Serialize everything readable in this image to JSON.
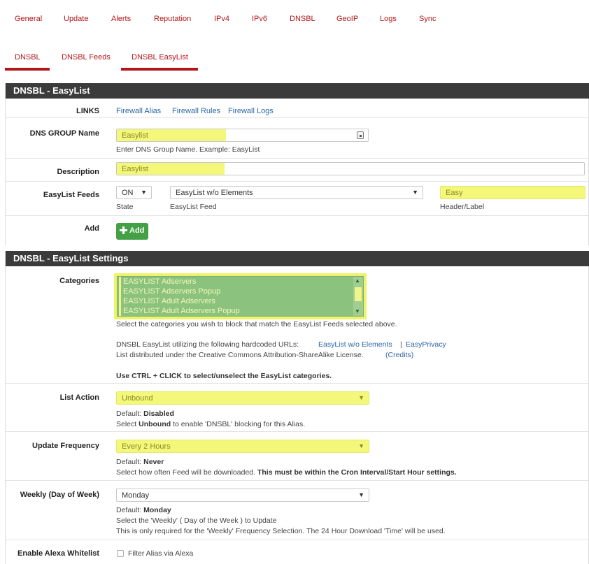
{
  "top_tabs": [
    "General",
    "Update",
    "Alerts",
    "Reputation",
    "IPv4",
    "IPv6",
    "DNSBL",
    "GeoIP",
    "Logs",
    "Sync"
  ],
  "sub_tabs": [
    "DNSBL",
    "DNSBL Feeds",
    "DNSBL EasyList"
  ],
  "panel1": {
    "title": "DNSBL - EasyList",
    "links_label": "LINKS",
    "links": [
      "Firewall Alias",
      "Firewall Rules",
      "Firewall Logs"
    ],
    "dns_group_label": "DNS GROUP Name",
    "dns_group_value": "Easylist",
    "dns_group_help": "Enter DNS Group Name.     Example: EasyList",
    "description_label": "Description",
    "description_value": "Easylist",
    "feeds_label": "EasyList Feeds",
    "state_value": "ON",
    "state_sub": "State",
    "feed_value": "EasyList w/o Elements",
    "feed_sub": "EasyList Feed",
    "header_value": "Easy",
    "header_sub": "Header/Label",
    "add_label": "Add",
    "add_button": "Add"
  },
  "panel2": {
    "title": "DNSBL - EasyList Settings",
    "categories_label": "Categories",
    "categories": [
      "EASYLIST Adservers",
      "EASYLIST Adservers Popup",
      "EASYLIST Adult Adservers",
      "EASYLIST Adult Adservers Popup"
    ],
    "categories_help1": "Select the categories you wish to block that match the EasyList Feeds selected above.",
    "categories_help2": "DNSBL EasyList utilizing the following hardcoded URLs:",
    "url_link1": "EasyList w/o Elements",
    "url_sep": "|",
    "url_link2": "EasyPrivacy",
    "categories_help3": "List distributed under the Creative Commons Attribution-ShareAlike License.",
    "credits_link": "(Credits)",
    "categories_help4": "Use CTRL + CLICK to select/unselect the EasyList categories.",
    "list_action_label": "List Action",
    "list_action_value": "Unbound",
    "list_action_default_prefix": "Default: ",
    "list_action_default": "Disabled",
    "list_action_help_pre": "Select ",
    "list_action_help_bold": "Unbound",
    "list_action_help_post": " to enable 'DNSBL' blocking for this Alias.",
    "update_freq_label": "Update Frequency",
    "update_freq_value": "Every 2 Hours",
    "update_default_prefix": "Default: ",
    "update_default": "Never",
    "update_help_pre": "Select how often Feed will be downloaded. ",
    "update_help_bold": "This must be within the Cron Interval/Start Hour settings.",
    "weekly_label": "Weekly (Day of Week)",
    "weekly_value": "Monday",
    "weekly_default_prefix": "Default: ",
    "weekly_default": "Monday",
    "weekly_help1": "Select the 'Weekly' ( Day of the Week ) to Update",
    "weekly_help2": "This is only required for the 'Weekly' Frequency Selection. The 24 Hour Download 'Time' will be used.",
    "alexa_label": "Enable Alexa Whitelist",
    "alexa_text": "Filter Alias via Alexa"
  },
  "icons": {
    "dropdown": "caret-down-icon",
    "add": "plus-icon",
    "field_key": "key-icon"
  },
  "colors": {
    "accent": "#b2161a",
    "header_bg": "#3b3b3b",
    "link": "#2c66a6",
    "highlight": "#f3f77a",
    "add_button": "#43a047",
    "listbox": "#8bc37e"
  }
}
